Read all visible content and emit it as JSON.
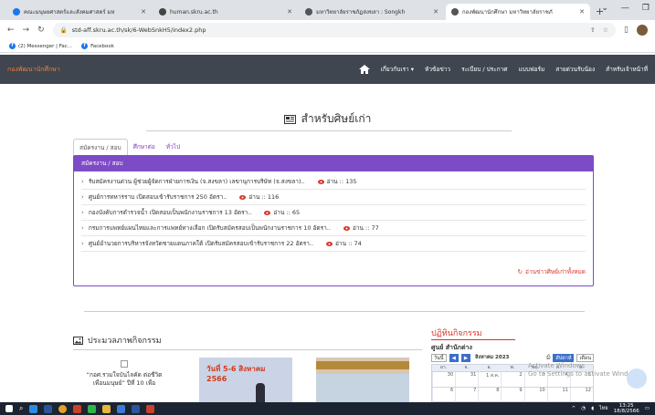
{
  "browser": {
    "tabs": [
      {
        "label": "คณะมนุษยศาสตร์และสังคมศาสตร์ มห",
        "active": false,
        "color": "#1877f2"
      },
      {
        "label": "human.skru.ac.th",
        "active": false,
        "color": "#444444"
      },
      {
        "label": "มหาวิทยาลัยราชภัฏสงขลา : Songkh",
        "active": false,
        "color": "#555555"
      },
      {
        "label": "กองพัฒนานักศึกษา มหาวิทยาลัยราชภั",
        "active": true,
        "color": "#555555"
      }
    ],
    "tab_close": "✕",
    "new_tab": "+",
    "url": "std-aff.skru.ac.th/sk/6-WebSnkH5/index2.php",
    "bookmarks": [
      {
        "label": "(2) Messenger | Fac..."
      },
      {
        "label": "Facebook"
      }
    ]
  },
  "site": {
    "brand": "กองพัฒนานักศึกษา",
    "menu": [
      "เกี่ยวกับเรา ▾",
      "หัวข้อข่าว",
      "ระเบียบ / ประกาศ",
      "แบบฟอร์ม",
      "สายด่วนรับน้อง",
      "สำหรับเจ้าหน้าที่"
    ]
  },
  "page": {
    "title": "สำหรับศิษย์เก่า",
    "tabs": [
      {
        "label": "สมัครงาน / สอบ",
        "active": true
      },
      {
        "label": "ศึกษาต่อ",
        "active": false
      },
      {
        "label": "ทั่วไป",
        "active": false
      }
    ],
    "panel_heading": "สมัครงาน / สอบ",
    "news": [
      {
        "title": "รับสมัครงานด่วน ผู้ช่วยผู้จัดการฝ่ายการเงิน (จ.สงขลา) เลขานุการบริษัท (จ.สงขลา)..",
        "views": "อ่าน :: 135"
      },
      {
        "title": "ศูนย์การทหารราบ เปิดสอบเข้ารับราชการ 250 อัตรา..",
        "views": "อ่าน :: 116"
      },
      {
        "title": "กองบังคับการตำรวจน้ำ เปิดสอบเป็นพนักงานราชการ 13 อัตรา..",
        "views": "อ่าน :: 65"
      },
      {
        "title": "กรมการแพทย์แผนไทยและการแพทย์ทางเลือก เปิดรับสมัครสอบเป็นพนักงานราชการ 10 อัตรา..",
        "views": "อ่าน :: 77"
      },
      {
        "title": "ศูนย์อำนวยการบริหารจังหวัดชายแดนภาคใต้ เปิดรับสมัครสอบเข้ารับราชการ 22 อัตรา..",
        "views": "อ่าน :: 74"
      }
    ],
    "more_link": "อ่านข่าวศิษย์เก่าทั้งหมด",
    "gallery_title": "ประมวลภาพกิจกรรม",
    "gallery": [
      {
        "caption": "“กอศ.รวมใจบันไลคัด ต่อชีวิต เพื่อนมนุษย์” ปีที่ 10 เพื่อ"
      },
      {
        "caption": "วันที่ 5-6 สิงหาคม 2566"
      },
      {
        "caption": ""
      }
    ],
    "calendar": {
      "title": "ปฏิทินกิจกรรม",
      "subtitle": "ศูนย์ สำนักต่าง",
      "today_btn": "วันนี้",
      "month_label": "สิงหาคม 2023",
      "views": [
        "สัปดาห์",
        "เดือน"
      ],
      "weekdays": [
        "อา.",
        "จ.",
        "อ.",
        "พ.",
        "พฤ.",
        "ศ.",
        "ส."
      ],
      "row1": [
        "30",
        "31",
        "1 ส.ค.",
        "2",
        "3",
        "4",
        "5"
      ],
      "row2": [
        "6",
        "7",
        "8",
        "9",
        "10",
        "11",
        "12"
      ]
    }
  },
  "overlay": {
    "watermark_line1": "Activate Windows",
    "watermark_line2": "Go to Settings to activate Windows."
  },
  "taskbar": {
    "lang": "ไทย",
    "time": "13:25",
    "date": "18/8/2566"
  }
}
